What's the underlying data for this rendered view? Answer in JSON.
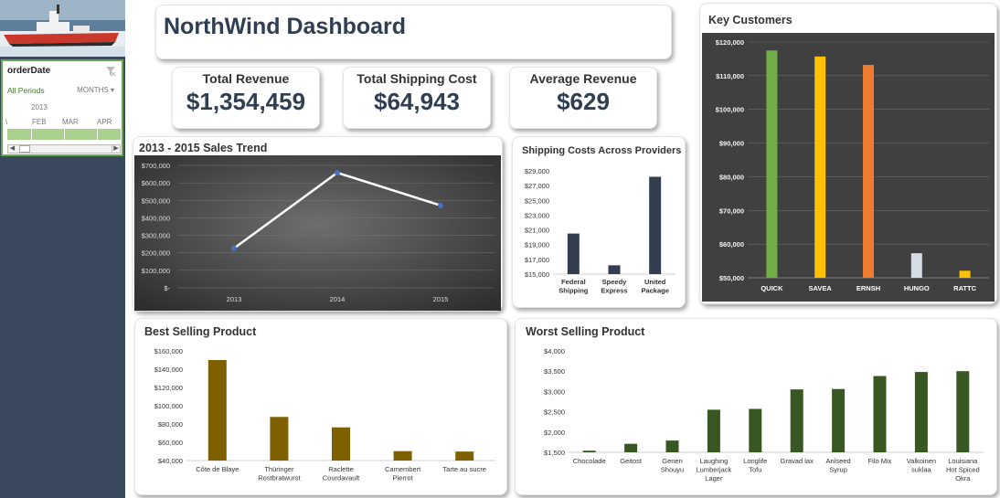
{
  "dashboard": {
    "title": "NorthWind Dashboard",
    "colors": {
      "navy": "#2f3e52",
      "sidebar": "#3a4a5c",
      "olive": "#7f6000",
      "green": "#385723"
    }
  },
  "slicer": {
    "title": "orderDate",
    "period_label": "All Periods",
    "unit_label": "MONTHS",
    "year": "2013",
    "months": [
      "FEB",
      "MAR",
      "APR"
    ],
    "icons": [
      "filter-clear-icon",
      "chevron-down-icon",
      "scroll-left-icon",
      "scroll-right-icon"
    ]
  },
  "kpis": [
    {
      "label": "Total Revenue",
      "value": "$1,354,459"
    },
    {
      "label": "Total Shipping Cost",
      "value": "$64,943"
    },
    {
      "label": "Average Revenue",
      "value": "$629"
    }
  ],
  "chart_data": [
    {
      "id": "sales-trend",
      "type": "line",
      "title": "2013 - 2015 Sales Trend",
      "categories": [
        "2013",
        "2014",
        "2015"
      ],
      "values": [
        226000,
        658000,
        471000
      ],
      "ylim": [
        0,
        700000
      ],
      "yticks": [
        "$-",
        "$100,000",
        "$200,000",
        "$300,000",
        "$400,000",
        "$500,000",
        "$600,000",
        "$700,000"
      ],
      "grid": true
    },
    {
      "id": "shipping-costs",
      "type": "bar",
      "title": "Shipping Costs Across Providers",
      "categories": [
        [
          "Federal",
          "Shipping"
        ],
        [
          "Speedy",
          "Express"
        ],
        [
          "United",
          "Package"
        ]
      ],
      "values": [
        20500,
        16200,
        28200
      ],
      "ylim": [
        15000,
        29000
      ],
      "yticks": [
        "$15,000",
        "$17,000",
        "$19,000",
        "$21,000",
        "$23,000",
        "$25,000",
        "$27,000",
        "$29,000"
      ],
      "color": "#333f50"
    },
    {
      "id": "key-customers",
      "type": "bar",
      "title": "Key Customers",
      "categories": [
        [
          "QUICK"
        ],
        [
          "SAVEA"
        ],
        [
          "ERNSH"
        ],
        [
          "HUNGO"
        ],
        [
          "RATTC"
        ]
      ],
      "values": [
        117500,
        115700,
        113200,
        57300,
        52100
      ],
      "ylim": [
        50000,
        120000
      ],
      "yticks": [
        "$50,000",
        "$60,000",
        "$70,000",
        "$80,000",
        "$90,000",
        "$100,000",
        "$110,000",
        "$120,000"
      ],
      "colors": [
        "#70ad47",
        "#ffc000",
        "#ed7d31",
        "#d6dce4",
        "#ffc000"
      ],
      "grid": true
    },
    {
      "id": "best-selling",
      "type": "bar",
      "title": "Best Selling Product",
      "categories": [
        [
          "Côte de Blaye"
        ],
        [
          "Thüringer",
          "Rostbratwurst"
        ],
        [
          "Raclette",
          "Courdavault"
        ],
        [
          "Camembert",
          "Pierrot"
        ],
        [
          "Tarte au sucre"
        ]
      ],
      "values": [
        149984,
        87736,
        76296,
        50286,
        49828
      ],
      "ylim": [
        40000,
        160000
      ],
      "yticks": [
        "$40,000",
        "$60,000",
        "$80,000",
        "$100,000",
        "$120,000",
        "$140,000",
        "$160,000"
      ],
      "color": "#7f6000"
    },
    {
      "id": "worst-selling",
      "type": "bar",
      "title": "Worst Selling Product",
      "categories": [
        [
          "Chocolade"
        ],
        [
          "Geitost"
        ],
        [
          "Genen",
          "Shouyu"
        ],
        [
          "Laughing",
          "Lumberjack",
          "Lager"
        ],
        [
          "Longlife",
          "Tofu"
        ],
        [
          "Gravad lax"
        ],
        [
          "Aniseed",
          "Syrup"
        ],
        [
          "Filo Mix"
        ],
        [
          "Valkoinen",
          "suklaa"
        ],
        [
          "Louisiana",
          "Hot Spiced",
          "Okra"
        ]
      ],
      "values": [
        1540,
        1710,
        1790,
        2550,
        2570,
        3050,
        3060,
        3380,
        3480,
        3500
      ],
      "ylim": [
        1500,
        4000
      ],
      "yticks": [
        "$1,500",
        "$2,000",
        "$2,500",
        "$3,000",
        "$3,500",
        "$4,000"
      ],
      "color": "#385723"
    }
  ]
}
